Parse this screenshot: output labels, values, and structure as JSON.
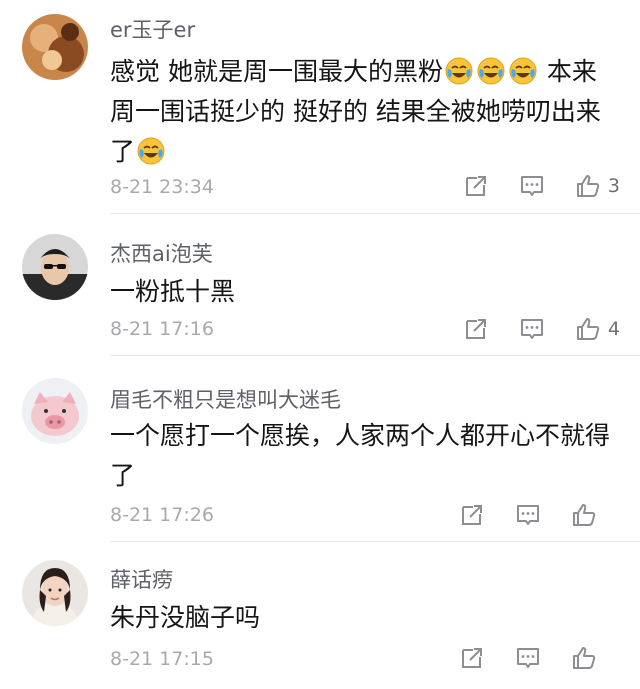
{
  "comments": [
    {
      "username": "er玉子er",
      "text_part1": "感觉 她就是周一围最大的黑粉",
      "text_part2": " 本来周一围话挺少的 挺好的 结果全被她唠叨出来了",
      "emoji": "laughing-crying-emoji",
      "timestamp": "8-21 23:34",
      "like_count": "3"
    },
    {
      "username": "杰西ai泡芙",
      "text": "一粉抵十黑",
      "timestamp": "8-21 17:16",
      "like_count": "4"
    },
    {
      "username": "眉毛不粗只是想叫大迷毛",
      "text": "一个愿打一个愿挨，人家两个人都开心不就得了",
      "timestamp": "8-21 17:26",
      "like_count": ""
    },
    {
      "username": "薛话痨",
      "text": "朱丹没脑子吗",
      "timestamp": "8-21 17:15",
      "like_count": ""
    }
  ],
  "icons": {
    "share": "share-icon",
    "comment": "comment-icon",
    "like": "thumbs-up-icon"
  },
  "colors": {
    "username": "#5f6168",
    "timestamp": "#a7a9ad",
    "icon": "#8c8e93",
    "divider": "#e8e8ea"
  }
}
